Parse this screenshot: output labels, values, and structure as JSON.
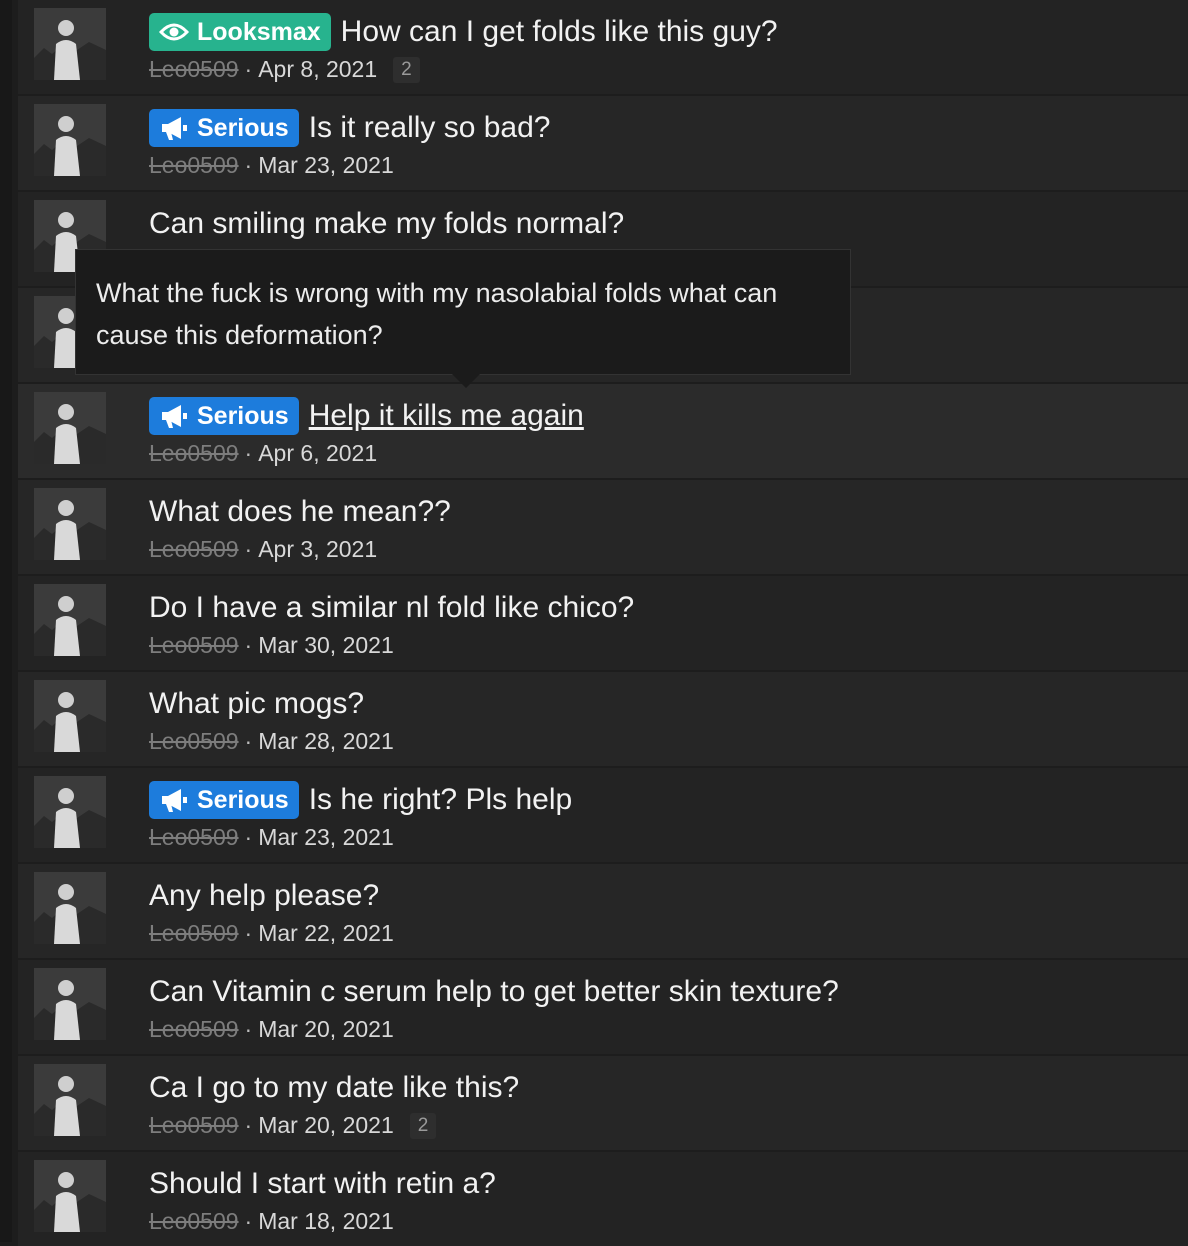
{
  "tooltip": {
    "text": "What the fuck is wrong with my nasolabial folds what can cause this deformation?"
  },
  "threads": [
    {
      "prefix": "Looksmax",
      "prefix_color": "#27b38e",
      "prefix_icon": "eye-icon",
      "title": "How can I get folds like this guy?",
      "author": "Leo0509",
      "date": "Apr 8, 2021",
      "replies": "2"
    },
    {
      "prefix": "Serious",
      "prefix_color": "#1d7cdc",
      "prefix_icon": "megaphone-icon",
      "title": "Is it really so bad?",
      "author": "Leo0509",
      "date": "Mar 23, 2021"
    },
    {
      "title": "Can smiling make my folds normal?"
    },
    {},
    {
      "prefix": "Serious",
      "prefix_color": "#1d7cdc",
      "prefix_icon": "megaphone-icon",
      "title": "Help it kills me again",
      "author": "Leo0509",
      "date": "Apr 6, 2021"
    },
    {
      "title": "What does he mean??",
      "author": "Leo0509",
      "date": "Apr 3, 2021"
    },
    {
      "title": "Do I have a similar nl fold like chico?",
      "author": "Leo0509",
      "date": "Mar 30, 2021"
    },
    {
      "title": "What pic mogs?",
      "author": "Leo0509",
      "date": "Mar 28, 2021"
    },
    {
      "prefix": "Serious",
      "prefix_color": "#1d7cdc",
      "prefix_icon": "megaphone-icon",
      "title": "Is he right? Pls help",
      "author": "Leo0509",
      "date": "Mar 23, 2021"
    },
    {
      "title": "Any help please?",
      "author": "Leo0509",
      "date": "Mar 22, 2021"
    },
    {
      "title": "Can Vitamin c serum help to get better skin texture?",
      "author": "Leo0509",
      "date": "Mar 20, 2021"
    },
    {
      "title": "Ca I go to my date like this?",
      "author": "Leo0509",
      "date": "Mar 20, 2021",
      "replies": "2"
    },
    {
      "title": "Should I start with retin a?",
      "author": "Leo0509",
      "date": "Mar 18, 2021"
    }
  ]
}
